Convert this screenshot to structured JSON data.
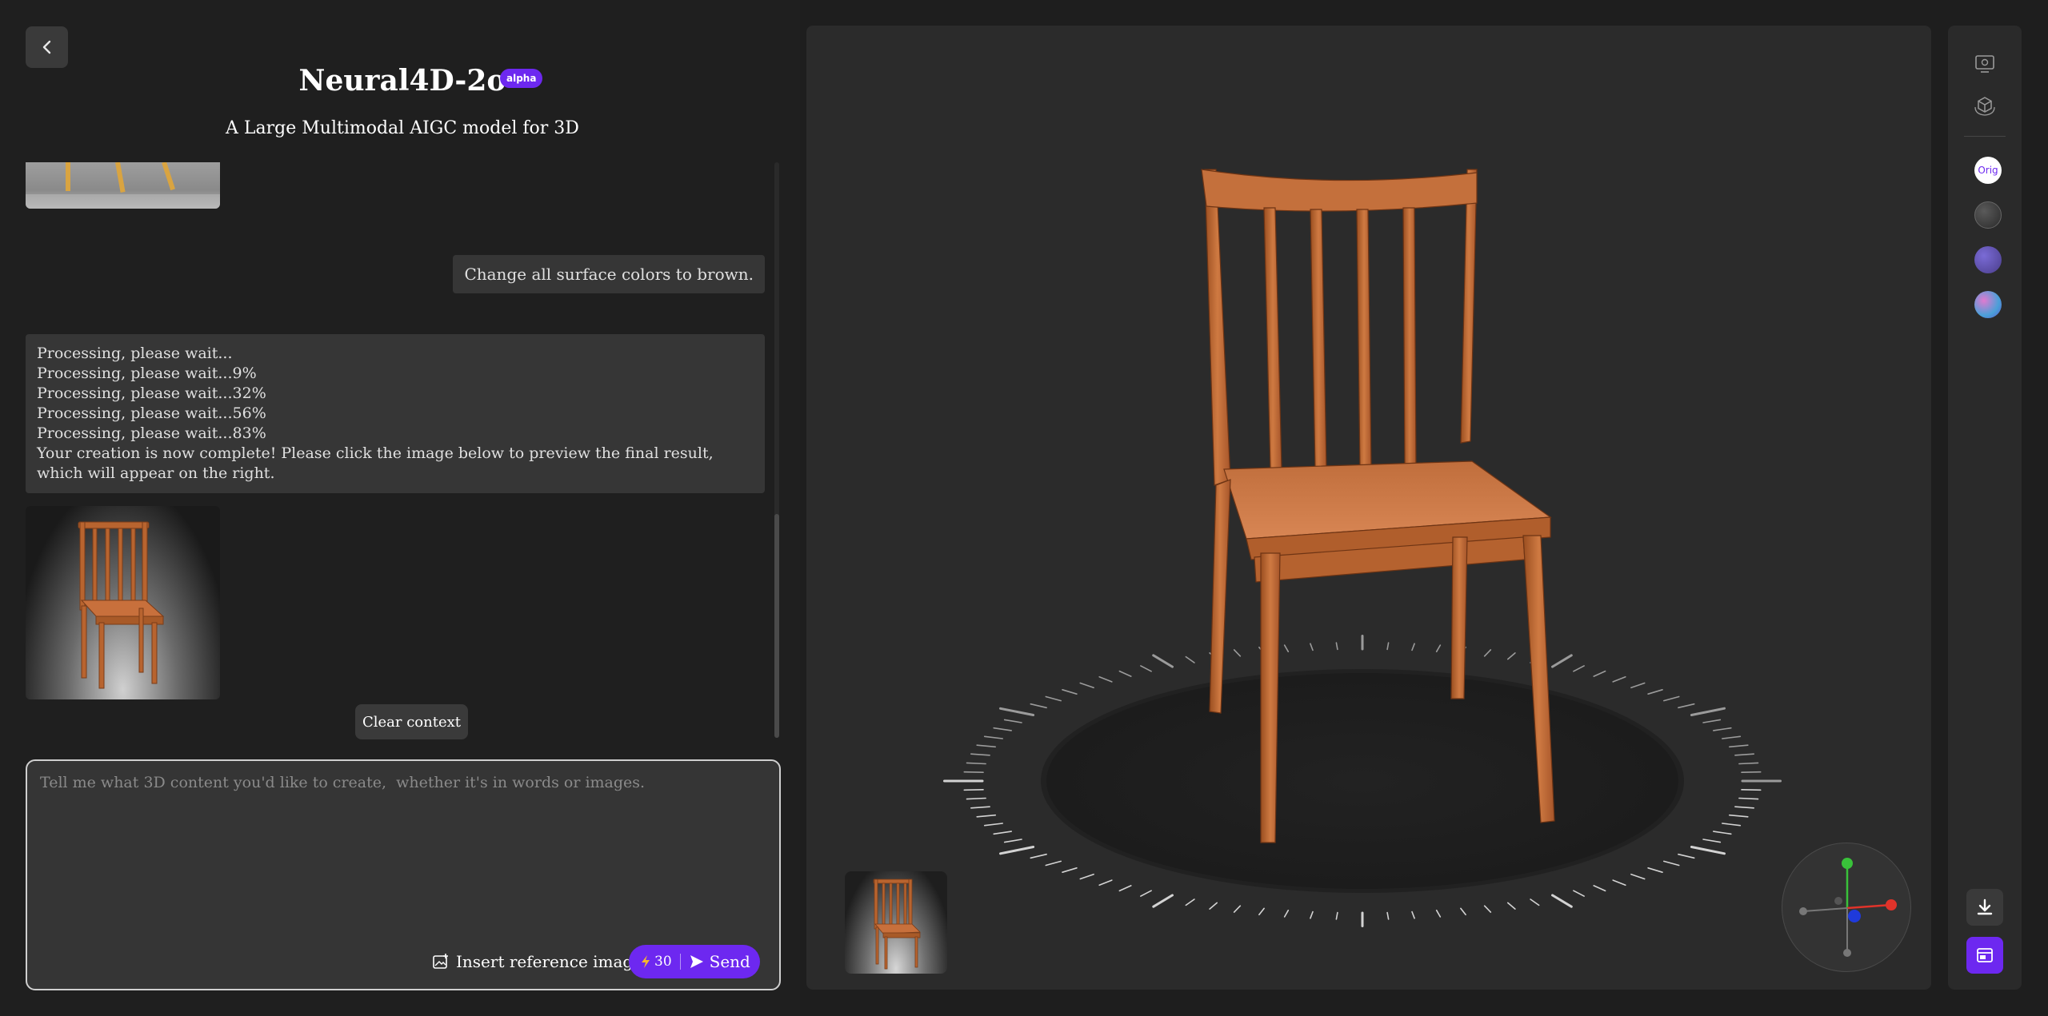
{
  "header": {
    "title": "Neural4D-2o",
    "badge": "alpha",
    "subtitle": "A Large Multimodal AIGC model for 3D"
  },
  "chat": {
    "user_message": "Change all surface colors to brown.",
    "bot_lines": [
      "Processing, please wait...",
      "Processing, please wait...9%",
      "Processing, please wait...32%",
      "Processing, please wait...56%",
      "Processing, please wait...83%",
      "Your creation is now complete! Please click the image below to preview the final result, which will appear on the right."
    ],
    "clear_label": "Clear context"
  },
  "input": {
    "placeholder": "Tell me what 3D content you'd like to create,  whether it's in words or images.",
    "insert_label": "Insert reference image",
    "credits": "30",
    "send_label": "Send"
  },
  "toolbar": {
    "swatch_orig_label": "Orig"
  },
  "icons": {
    "back": "chevron-left-icon",
    "insert": "image-add-icon",
    "credit": "lightning-icon",
    "send": "send-icon",
    "download": "download-icon",
    "screenshot": "screenshot-icon"
  },
  "colors": {
    "accent": "#6d28f0",
    "chair": "#c8703c"
  }
}
